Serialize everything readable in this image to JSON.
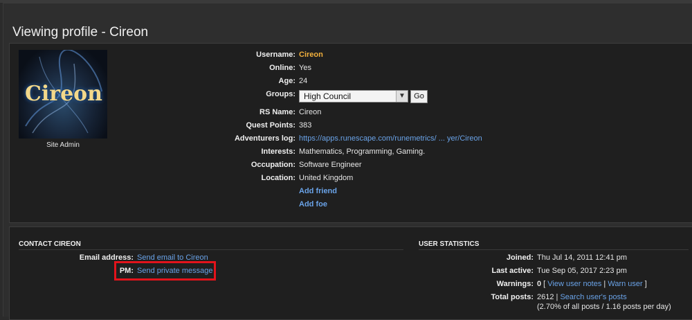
{
  "page": {
    "title": "Viewing profile - Cireon"
  },
  "avatar": {
    "text": "Cireon",
    "rank": "Site Admin"
  },
  "profile": {
    "username_label": "Username:",
    "username": "Cireon",
    "online_label": "Online:",
    "online": "Yes",
    "age_label": "Age:",
    "age": "24",
    "groups_label": "Groups:",
    "groups_selected": "High Council",
    "go_label": "Go",
    "rsname_label": "RS Name:",
    "rsname": "Cireon",
    "questpoints_label": "Quest Points:",
    "questpoints": "383",
    "advlog_label": "Adventurers log:",
    "advlog": "https://apps.runescape.com/runemetrics/ ... yer/Cireon",
    "interests_label": "Interests:",
    "interests": "Mathematics, Programming, Gaming.",
    "occupation_label": "Occupation:",
    "occupation": "Software Engineer",
    "location_label": "Location:",
    "location": "United Kingdom",
    "add_friend": "Add friend",
    "add_foe": "Add foe"
  },
  "contact": {
    "heading": "CONTACT CIREON",
    "email_label": "Email address:",
    "email_link": "Send email to Cireon",
    "pm_label": "PM:",
    "pm_link": "Send private message"
  },
  "stats": {
    "heading": "USER STATISTICS",
    "joined_label": "Joined:",
    "joined": "Thu Jul 14, 2011 12:41 pm",
    "lastactive_label": "Last active:",
    "lastactive": "Tue Sep 05, 2017 2:23 pm",
    "warnings_label": "Warnings:",
    "warnings_count": "0",
    "warnings_open": " [ ",
    "view_notes": "View user notes",
    "sep": " | ",
    "warn_user": "Warn user",
    "warnings_close": " ]",
    "posts_label": "Total posts:",
    "posts_count": "2612",
    "posts_sep": " | ",
    "search_posts": "Search user's posts",
    "posts_detail": "(2.70% of all posts / 1.16 posts per day)"
  },
  "colors": {
    "accent_link": "#6aa3e8",
    "username": "#f2b03c",
    "highlight": "#e3131b"
  }
}
